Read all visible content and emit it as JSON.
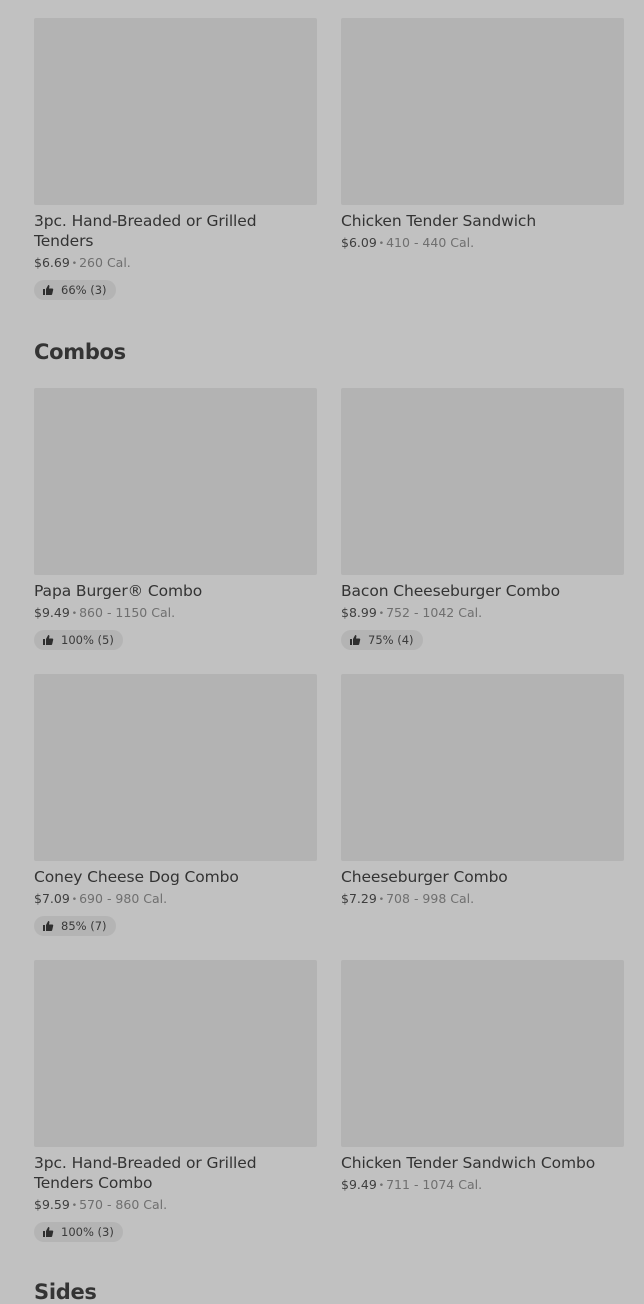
{
  "sections": [
    {
      "title": "",
      "items": [
        {
          "name": "3pc. Hand-Breaded or Grilled Tenders",
          "price": "$6.69",
          "calories": "260 Cal.",
          "rating": "66% (3)"
        },
        {
          "name": "Chicken Tender Sandwich",
          "price": "$6.09",
          "calories": "410 - 440 Cal.",
          "rating": ""
        }
      ]
    },
    {
      "title": "Combos",
      "items": [
        {
          "name": "Papa Burger® Combo",
          "price": "$9.49",
          "calories": "860 - 1150 Cal.",
          "rating": "100% (5)"
        },
        {
          "name": "Bacon Cheeseburger Combo",
          "price": "$8.99",
          "calories": "752 - 1042 Cal.",
          "rating": "75% (4)"
        },
        {
          "name": "Coney Cheese Dog Combo",
          "price": "$7.09",
          "calories": "690 - 980 Cal.",
          "rating": "85% (7)"
        },
        {
          "name": "Cheeseburger Combo",
          "price": "$7.29",
          "calories": "708 - 998 Cal.",
          "rating": ""
        },
        {
          "name": "3pc. Hand-Breaded or Grilled Tenders Combo",
          "price": "$9.59",
          "calories": "570 - 860 Cal.",
          "rating": "100% (3)"
        },
        {
          "name": "Chicken Tender Sandwich Combo",
          "price": "$9.49",
          "calories": "711 - 1074 Cal.",
          "rating": ""
        }
      ]
    },
    {
      "title": "Sides",
      "items": []
    }
  ],
  "separator": "•",
  "icons": {
    "rating": "thumbs-up-icon"
  },
  "colors": {
    "background": "#c1c1c1",
    "image_placeholder": "#b3b3b3",
    "badge": "#b4b4b4",
    "text": "#333333",
    "muted": "#6f6f6f"
  }
}
